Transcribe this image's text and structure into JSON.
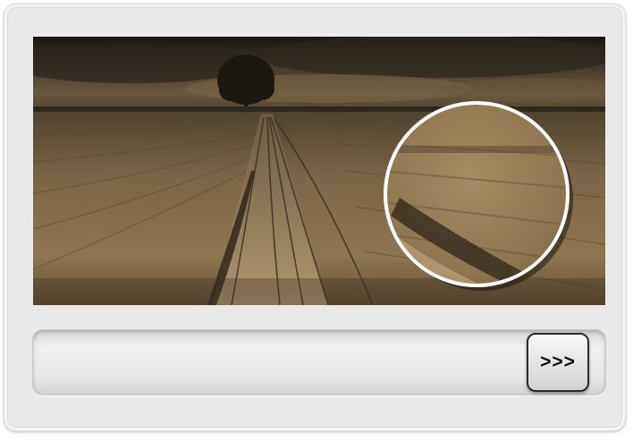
{
  "search": {
    "value": "",
    "placeholder": ""
  },
  "submit_button": {
    "label": ">>>"
  },
  "colors": {
    "panel": "#e9e9e9",
    "photo_sky": "#3a3124",
    "photo_field": "#8a7352",
    "magnifier_ring": "#ffffff",
    "button_border": "#2a2a2a"
  }
}
